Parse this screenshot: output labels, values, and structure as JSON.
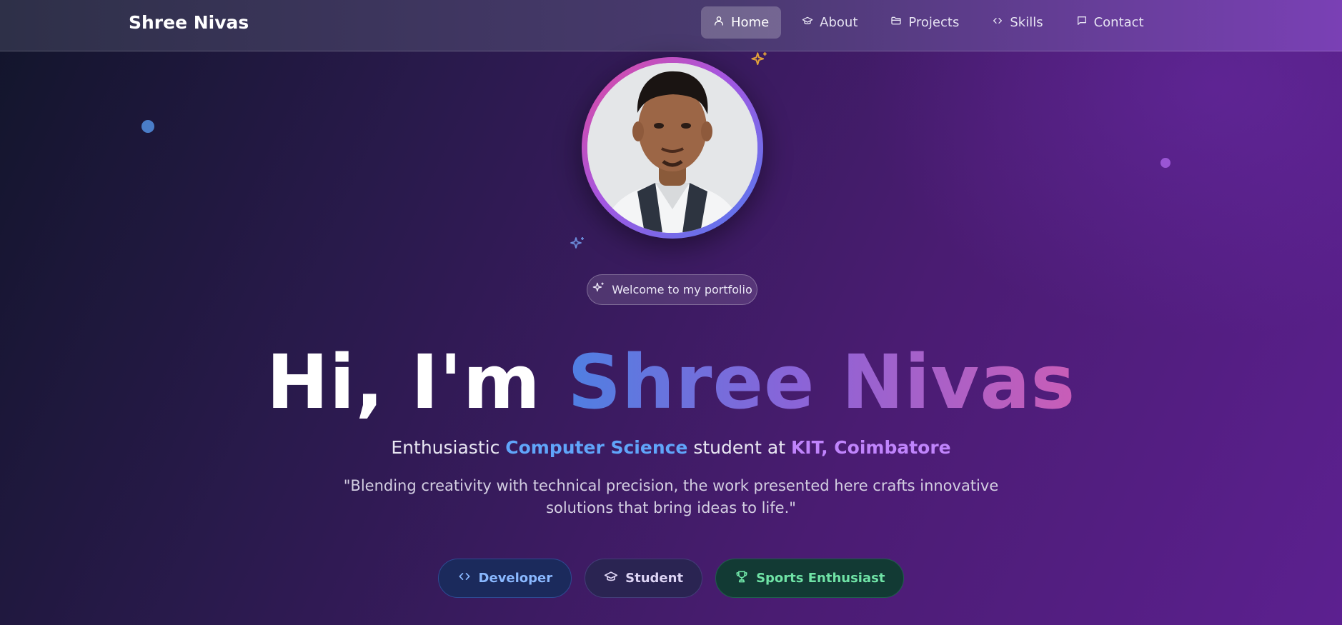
{
  "brand": {
    "name": "Shree Nivas"
  },
  "nav": {
    "items": [
      {
        "label": "Home",
        "icon": "user-icon",
        "active": true
      },
      {
        "label": "About",
        "icon": "graduation-cap-icon",
        "active": false
      },
      {
        "label": "Projects",
        "icon": "folder-icon",
        "active": false
      },
      {
        "label": "Skills",
        "icon": "code-icon",
        "active": false
      },
      {
        "label": "Contact",
        "icon": "message-icon",
        "active": false
      }
    ]
  },
  "hero": {
    "welcome": "Welcome to my portfolio",
    "title_prefix": "Hi, I'm ",
    "title_name": "Shree Nivas",
    "subtitle": {
      "part1": "Enthusiastic ",
      "highlight1": "Computer Science",
      "part2": " student at ",
      "highlight2": "KIT, Coimbatore"
    },
    "quote": "\"Blending creativity with technical precision, the work presented here crafts innovative solutions that bring ideas to life.\""
  },
  "tags": [
    {
      "label": "Developer",
      "icon": "code-icon"
    },
    {
      "label": "Student",
      "icon": "graduation-cap-icon"
    },
    {
      "label": "Sports Enthusiast",
      "icon": "trophy-icon"
    }
  ],
  "colors": {
    "accent_blue": "#60a5fa",
    "accent_purple": "#c084fc",
    "accent_green": "#6fe3a6"
  }
}
